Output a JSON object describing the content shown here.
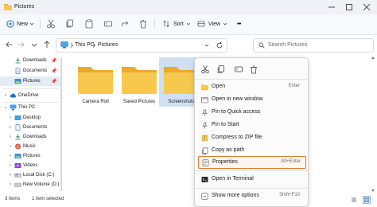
{
  "window": {
    "title": "Pictures"
  },
  "toolbar": {
    "new_label": "New",
    "sort_label": "Sort",
    "view_label": "View",
    "more_label": "•••"
  },
  "address": {
    "this_pc": "This PC",
    "pictures": "Pictures",
    "search_placeholder": "Search Pictures"
  },
  "sidebar": {
    "quick": [
      {
        "label": "Downloads",
        "icon": "download-icon"
      },
      {
        "label": "Documents",
        "icon": "document-icon"
      },
      {
        "label": "Pictures",
        "icon": "pictures-icon"
      }
    ],
    "onedrive": "OneDrive",
    "this_pc": "This PC",
    "pc_items": [
      {
        "label": "Desktop",
        "icon": "desktop-icon"
      },
      {
        "label": "Documents",
        "icon": "document-icon"
      },
      {
        "label": "Downloads",
        "icon": "download-icon"
      },
      {
        "label": "Music",
        "icon": "music-icon"
      },
      {
        "label": "Pictures",
        "icon": "pictures-icon"
      },
      {
        "label": "Videos",
        "icon": "videos-icon"
      },
      {
        "label": "Local Disk (C:)",
        "icon": "drive-icon"
      },
      {
        "label": "New Volume (D:)",
        "icon": "drive-icon"
      }
    ]
  },
  "folders": [
    {
      "label": "Camera Roll"
    },
    {
      "label": "Saved Pictures"
    },
    {
      "label": "Screenshots"
    }
  ],
  "status": {
    "items": "3 items",
    "selected": "1 item selected"
  },
  "context_menu": {
    "items": [
      {
        "label": "Open",
        "shortcut": "Enter",
        "icon": "open-folder-icon"
      },
      {
        "label": "Open in new window",
        "shortcut": "",
        "icon": "new-window-icon"
      },
      {
        "label": "Pin to Quick access",
        "shortcut": "",
        "icon": "pin-icon"
      },
      {
        "label": "Pin to Start",
        "shortcut": "",
        "icon": "pin-start-icon"
      },
      {
        "label": "Compress to ZIP file",
        "shortcut": "",
        "icon": "zip-icon"
      },
      {
        "label": "Copy as path",
        "shortcut": "",
        "icon": "copy-path-icon"
      },
      {
        "label": "Properties",
        "shortcut": "Alt+Enter",
        "icon": "properties-icon"
      },
      {
        "label": "Open in Terminal",
        "shortcut": "",
        "icon": "terminal-icon"
      },
      {
        "label": "Show more options",
        "shortcut": "Shift+F10",
        "icon": "more-options-icon"
      }
    ]
  },
  "colors": {
    "folder": "#f6c94e",
    "folder_back": "#e9ab2a",
    "accent": "#0067c0",
    "highlight_border": "#e0782a",
    "selection": "#cfe0f4"
  }
}
